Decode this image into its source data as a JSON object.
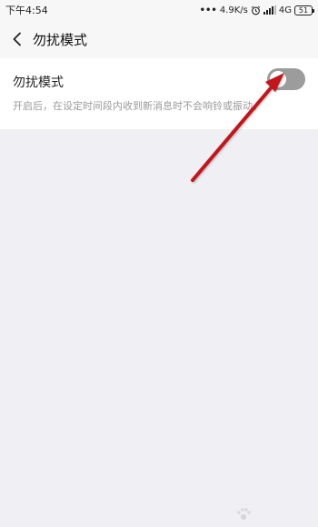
{
  "status_bar": {
    "time": "下午4:54",
    "network_speed": "4.9K/s",
    "network_type": "4G",
    "battery_level": "51",
    "icons": [
      "dots-icon",
      "alarm-icon",
      "signal-icon",
      "battery-icon"
    ]
  },
  "header": {
    "back_icon": "chevron-left-icon",
    "title": "勿扰模式"
  },
  "settings": {
    "dnd_row": {
      "title": "勿扰模式",
      "description": "开启后，在设定时间段内收到新消息时不会响铃或振动。",
      "toggle_on": false
    }
  },
  "annotation": {
    "arrow_color": "#c0161d"
  },
  "colors": {
    "background": "#efeff4",
    "card": "#ffffff",
    "toggle_off": "#9c9c9c"
  }
}
